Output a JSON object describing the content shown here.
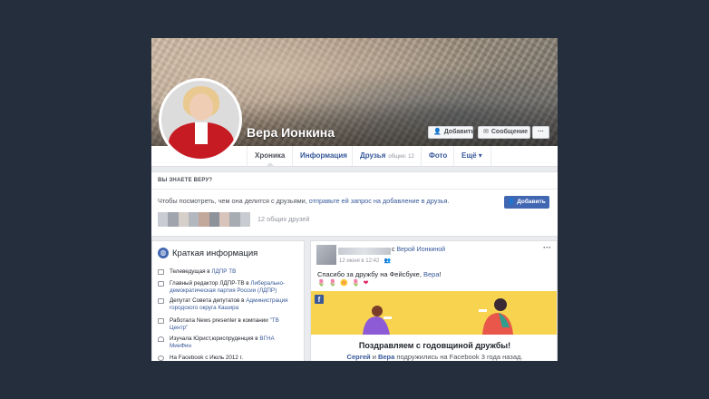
{
  "profile": {
    "name": "Вера Ионкина",
    "add_button": "Добавить",
    "message_button": "Сообщение",
    "more_button": "···"
  },
  "tabs": [
    {
      "label": "Хроника",
      "active": true
    },
    {
      "label": "Информация"
    },
    {
      "label": "Друзья",
      "count": "общие: 12"
    },
    {
      "label": "Фото"
    },
    {
      "label": "Ещё ▾"
    }
  ],
  "know": {
    "heading": "ВЫ ЗНАЕТЕ ВЕРУ?",
    "text": "Чтобы посмотреть, чем она делится с друзьями, ",
    "link": "отправьте ей запрос на добавление в друзья.",
    "mutual": "12 общих друзей",
    "add_button": "Добавить"
  },
  "intro": {
    "title": "Краткая информация",
    "items": [
      {
        "text": "Телеведущая в ",
        "link": "ЛДПР ТВ"
      },
      {
        "text": "Главный редактор ЛДПР-ТВ в ",
        "link": "Либерально-демократическая партия России (ЛДПР)"
      },
      {
        "text": "Депутат Совета депутатов в ",
        "link": "Администрация городского округа Кашира"
      },
      {
        "text": "Работала News presenter в компании ",
        "link": "\"ТВ Центр\""
      },
      {
        "text": "Изучала Юрист,юриспруденция в ",
        "link": "ВГНА МинФин"
      },
      {
        "text": "На Facebook с Июль 2012 г.",
        "link": ""
      }
    ]
  },
  "post": {
    "with_prefix": "с ",
    "with_link": "Верой Ионкиной",
    "date": "12 июня в 12:42 · ",
    "message_prefix": "Спасибо за дружбу на Фейсбуке, ",
    "message_link": "Вера",
    "message_suffix": "!",
    "emoji": "🌷 🌷 🌼 🌷 ❤",
    "more": "···",
    "card_title": "Поздравляем с годовщиной дружбы!",
    "card_name1": "Сергей",
    "card_and": " и ",
    "card_name2": "Вера",
    "card_rest": " подружились на Facebook 3 года назад."
  },
  "colors": {
    "fb_blue": "#4267b2",
    "link": "#365899",
    "banner": "#f7d34f",
    "background": "#252e3d"
  }
}
